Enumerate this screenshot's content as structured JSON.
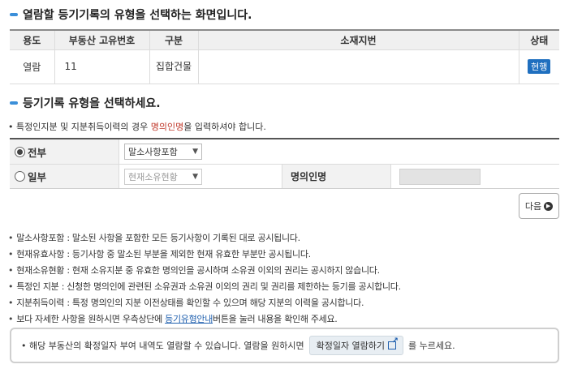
{
  "section1": {
    "title": "열람할 등기기록의 유형을 선택하는 화면입니다."
  },
  "table1": {
    "headers": [
      "용도",
      "부동산 고유번호",
      "구분",
      "소재지번",
      "상태"
    ],
    "row": {
      "usage": "열람",
      "property_id": "11",
      "category": "집합건물",
      "address": "",
      "status": "현행"
    }
  },
  "section2": {
    "title": "등기기록 유형을 선택하세요."
  },
  "note": {
    "prefix": "특정인지분 및 지분취득이력의 경우 ",
    "highlight": "명의인명",
    "suffix": "을 입력하셔야 합니다."
  },
  "options": {
    "all": {
      "label": "전부",
      "selected": true,
      "select_value": "말소사항포함"
    },
    "partial": {
      "label": "일부",
      "selected": false,
      "select_value": "현재소유현황",
      "name_label": "명의인명",
      "name_value": ""
    }
  },
  "next_button": {
    "label": "다음"
  },
  "bullets": [
    "말소사항포함 : 말소된 사항을 포함한 모든 등기사항이 기록된 대로 공시됩니다.",
    "현재유효사항 : 등기사항 중 말소된 부분을 제외한 현재 유효한 부분만 공시됩니다.",
    "현재소유현황 : 현재 소유지분 중 유효한 명의인을 공시하며 소유권 이외의 권리는 공시하지 않습니다.",
    "특정인 지분 : 신청한 명의인에 관련된 소유권과 소유권 이외의 권리 및 권리를 제한하는 등기를 공시합니다.",
    "지분취득이력 : 특정 명의인의 지분 이전상태를 확인할 수 있으며 해당 지분의 이력을 공시합니다."
  ],
  "last_bullet": {
    "prefix": "보다 자세한 사항을 원하시면 우측상단에 ",
    "link": "등기유형안내",
    "suffix": "버튼을 눌러 내용을 확인해 주세요."
  },
  "info": {
    "prefix": "해당 부동산의 확정일자 부여 내역도 열람할 수 있습니다. 열람을 원하시면 ",
    "button": "확정일자 열람하기",
    "suffix": "를 누르세요."
  }
}
